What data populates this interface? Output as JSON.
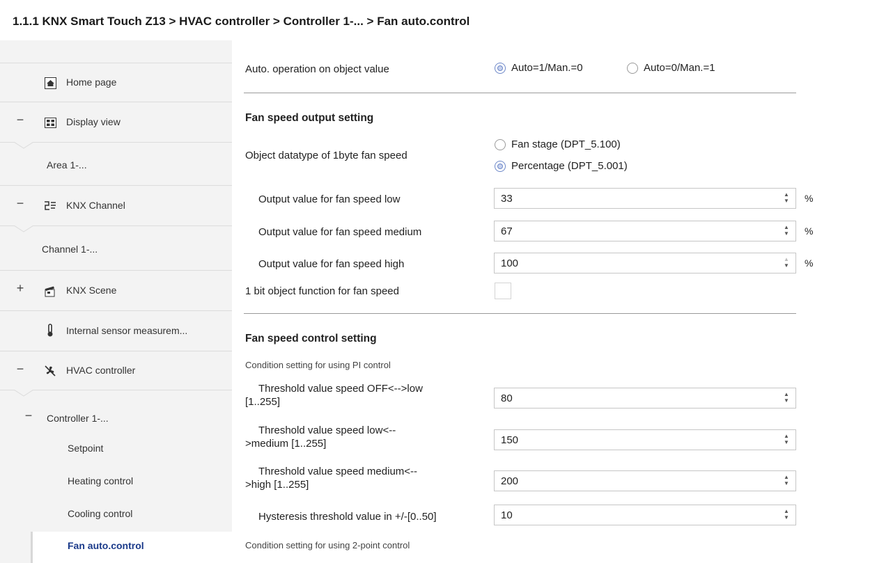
{
  "breadcrumb": "1.1.1 KNX Smart Touch Z13 > HVAC controller > Controller 1-... > Fan auto.control",
  "sidebar": {
    "items": [
      {
        "label": "Home page",
        "icon": "home-icon",
        "toggle": ""
      },
      {
        "label": "Display view",
        "icon": "grid-icon",
        "toggle": "−"
      },
      {
        "label": "Area 1-...",
        "icon": "",
        "toggle": ""
      },
      {
        "label": "KNX Channel",
        "icon": "channel-icon",
        "toggle": "−"
      },
      {
        "label": "Channel 1-...",
        "icon": "",
        "toggle": ""
      },
      {
        "label": "KNX Scene",
        "icon": "clapperboard-icon",
        "toggle": "+"
      },
      {
        "label": "Internal sensor measurem...",
        "icon": "thermometer-icon",
        "toggle": ""
      },
      {
        "label": "HVAC controller",
        "icon": "fan-icon",
        "toggle": "−"
      },
      {
        "label": "Controller 1-...",
        "icon": "",
        "toggle": "−"
      },
      {
        "label": "Setpoint",
        "icon": "",
        "toggle": ""
      },
      {
        "label": "Heating control",
        "icon": "",
        "toggle": ""
      },
      {
        "label": "Cooling control",
        "icon": "",
        "toggle": ""
      },
      {
        "label": "Fan auto.control",
        "icon": "",
        "toggle": "",
        "selected": true
      }
    ]
  },
  "main": {
    "auto_operation": {
      "label": "Auto. operation on object value",
      "options": [
        "Auto=1/Man.=0",
        "Auto=0/Man.=1"
      ],
      "selected": 0
    },
    "fan_output_section": "Fan speed output setting",
    "datatype": {
      "label": "Object datatype of 1byte fan speed",
      "options": [
        "Fan stage (DPT_5.100)",
        "Percentage (DPT_5.001)"
      ],
      "selected": 1
    },
    "outputs": [
      {
        "label": "Output value for fan speed low",
        "value": "33",
        "unit": "%"
      },
      {
        "label": "Output value for fan speed medium",
        "value": "67",
        "unit": "%"
      },
      {
        "label": "Output value for fan speed high",
        "value": "100",
        "unit": "%"
      }
    ],
    "one_bit": {
      "label": "1 bit object function for fan speed",
      "checked": false
    },
    "fan_control_section": "Fan speed control setting",
    "pi_note": "Condition setting for using PI control",
    "thresholds": [
      {
        "line1": "Threshold value speed OFF<-->low",
        "line2": "[1..255]",
        "value": "80"
      },
      {
        "line1": "Threshold value speed low<--",
        "line2": ">medium [1..255]",
        "value": "150"
      },
      {
        "line1": "Threshold value speed medium<--",
        "line2": ">high [1..255]",
        "value": "200"
      }
    ],
    "hysteresis": {
      "label": "Hysteresis threshold value in +/-[0..50]",
      "value": "10"
    },
    "two_point_note": "Condition setting for using 2-point control"
  },
  "colors": {
    "accent": "#6c87c8",
    "sidebar_bg": "#f3f3f3",
    "selected_text": "#1a3a8a"
  }
}
